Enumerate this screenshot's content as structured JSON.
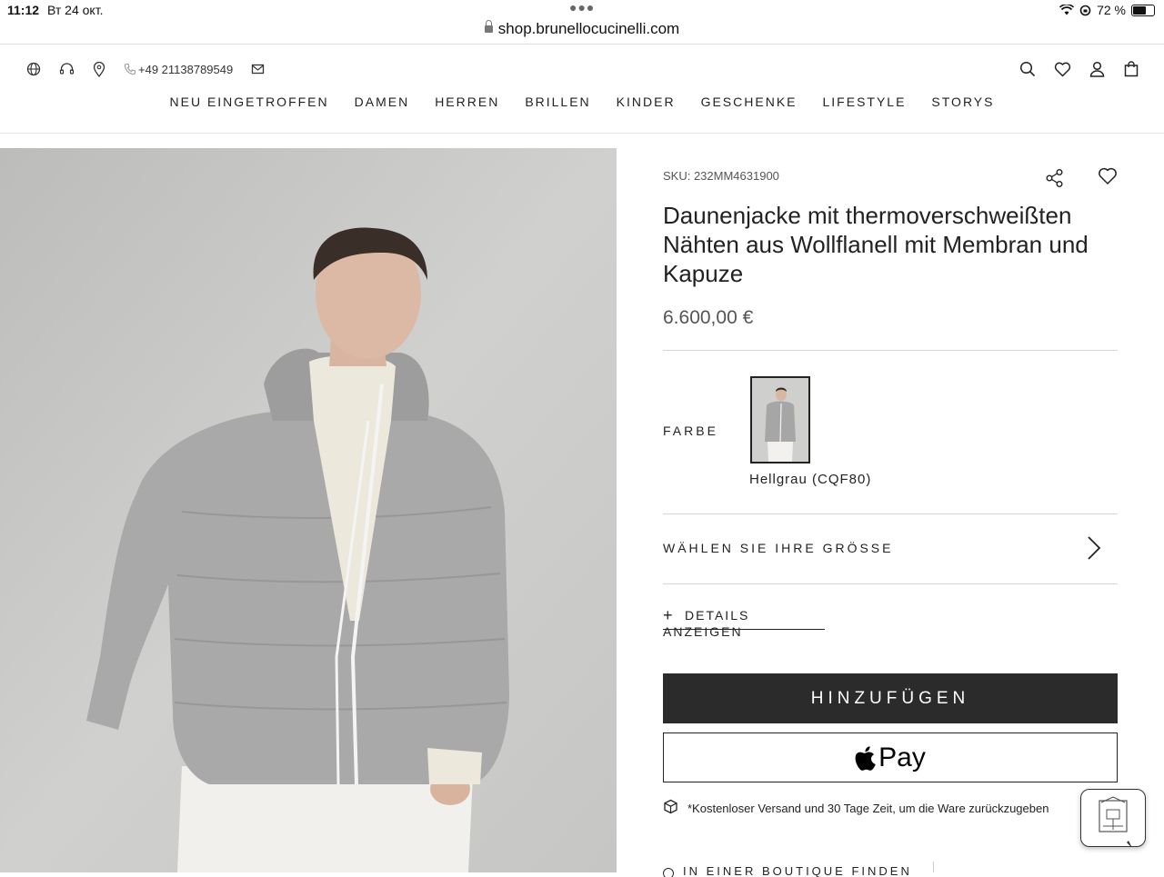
{
  "status_bar": {
    "time": "11:12",
    "date": "Вт 24 окт.",
    "battery_text": "72 %",
    "battery_level": 0.72
  },
  "browser": {
    "url": "shop.brunellocucinelli.com"
  },
  "utility": {
    "phone": "+49 21138789549"
  },
  "nav": {
    "items": [
      "NEU EINGETROFFEN",
      "DAMEN",
      "HERREN",
      "BRILLEN",
      "KINDER",
      "GESCHENKE",
      "LIFESTYLE",
      "STORYS"
    ]
  },
  "product": {
    "sku": "SKU: 232MM4631900",
    "title": "Daunenjacke mit thermoverschweißten Nähten aus Wollflanell mit Membran und Kapuze",
    "price": "6.600,00 €",
    "color_label": "FARBE",
    "color_name": "Hellgrau (CQF80)",
    "size_label": "WÄHLEN SIE IHRE GRÖSSE",
    "details_label": "DETAILS ANZEIGEN",
    "add_button": "HINZUFÜGEN",
    "apple_pay": "Pay",
    "shipping_note": "*Kostenloser Versand und 30 Tage Zeit, um die Ware zurückzugeben",
    "boutique_label": "IN EINER BOUTIQUE FINDEN"
  },
  "colors": {
    "button_dark": "#2b2b2b",
    "text": "#222222",
    "hero_bg": "#c9c9c7"
  }
}
